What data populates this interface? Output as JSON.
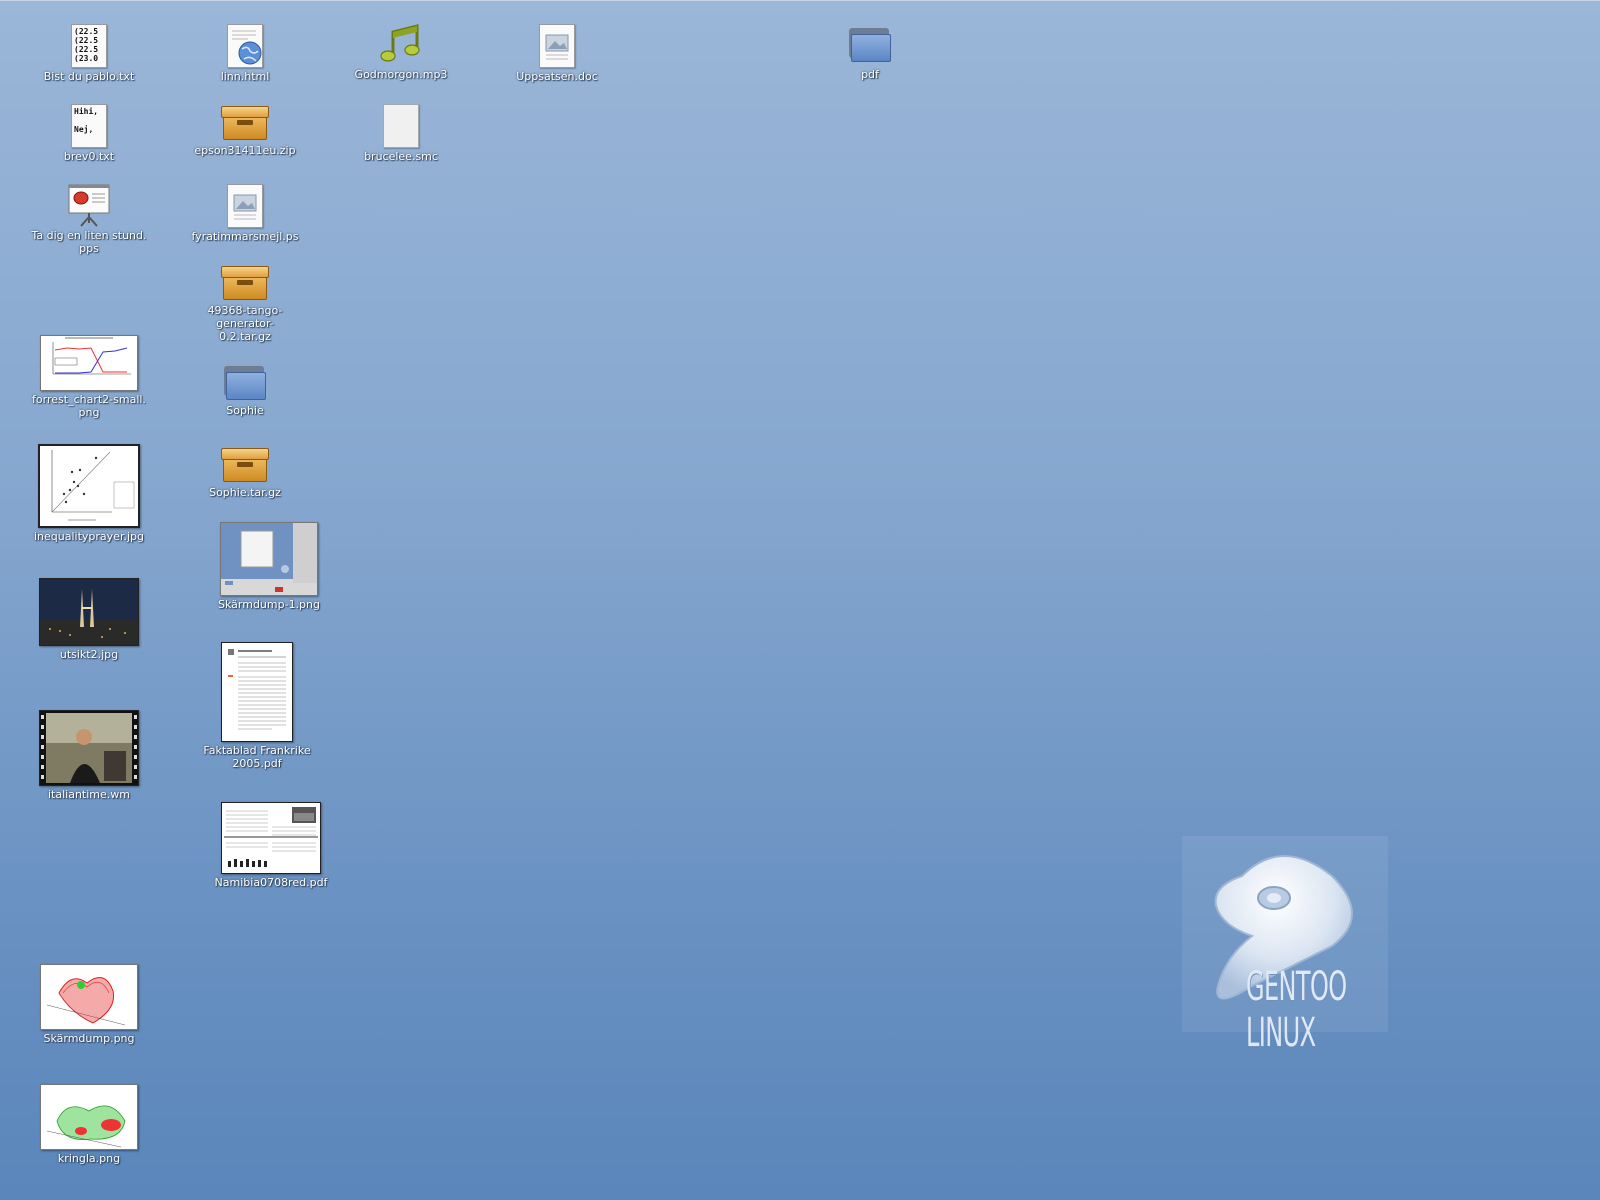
{
  "desktop": {
    "icons": [
      {
        "id": "bist",
        "label": "Bist du pablo.txt",
        "preview_lines": "(22.5\n(22.5\n(22.5\n(23.0"
      },
      {
        "id": "brev",
        "label": "brev0.txt",
        "preview_lines": "Hihi,\n\nNej,"
      },
      {
        "id": "pps",
        "label": "Ta dig en liten stund.\npps"
      },
      {
        "id": "forrest",
        "label": "forrest_chart2-small.\npng"
      },
      {
        "id": "ineq",
        "label": "inequalityprayer.jpg"
      },
      {
        "id": "utsikt",
        "label": "utsikt2.jpg"
      },
      {
        "id": "italian",
        "label": "italiantime.wm"
      },
      {
        "id": "skarm",
        "label": "Skärmdump.png"
      },
      {
        "id": "kringla",
        "label": "kringla.png"
      },
      {
        "id": "linn",
        "label": "linn.html"
      },
      {
        "id": "epson",
        "label": "epson31411eu.zip"
      },
      {
        "id": "fyra",
        "label": "fyratimmarsmejl.ps"
      },
      {
        "id": "tango",
        "label": "49368-tango-generator-\n0.2.tar.gz"
      },
      {
        "id": "sophie",
        "label": "Sophie"
      },
      {
        "id": "sophietar",
        "label": "Sophie.tar.gz"
      },
      {
        "id": "skarm1",
        "label": "Skärmdump-1.png"
      },
      {
        "id": "fakta",
        "label": "Faktablad Frankrike\n2005.pdf"
      },
      {
        "id": "namibia",
        "label": "Namibia0708red.pdf"
      },
      {
        "id": "godmorgon",
        "label": "Godmorgon.mp3"
      },
      {
        "id": "brucelee",
        "label": "brucelee.smc"
      },
      {
        "id": "uppsatsen",
        "label": "Uppsatsen.doc"
      },
      {
        "id": "pdf",
        "label": "pdf"
      }
    ]
  },
  "wallpaper": {
    "logo_text": "GENTOO LINUX",
    "background_top": "#9ab6d8",
    "background_bottom": "#5a86bb"
  }
}
